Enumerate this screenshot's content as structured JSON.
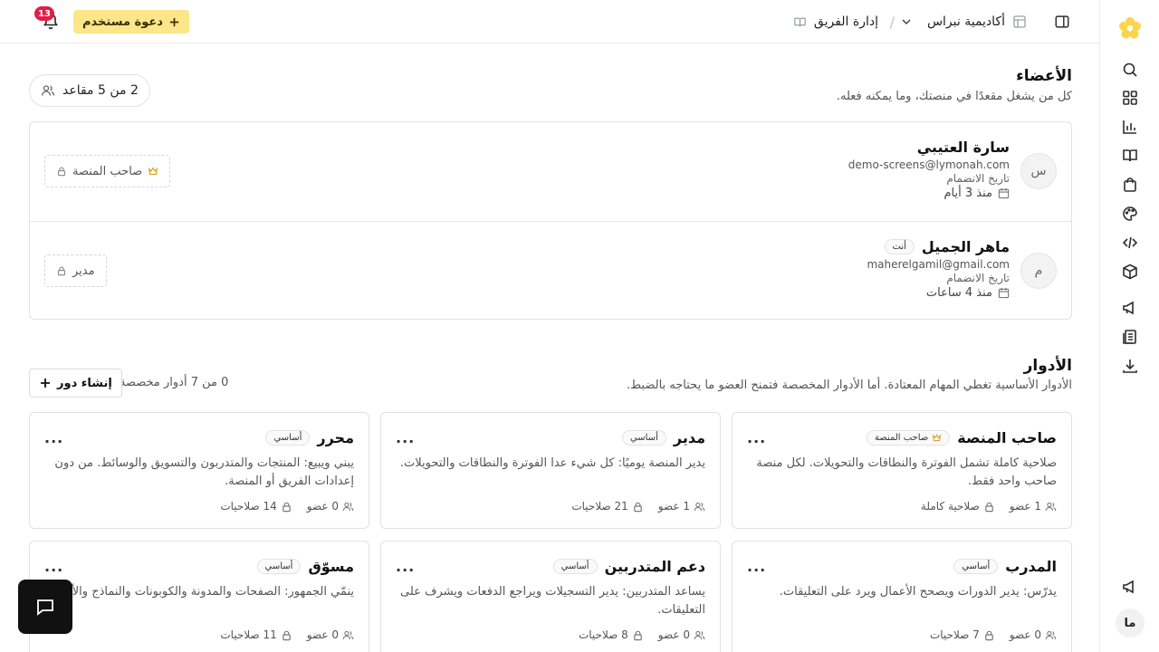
{
  "topbar": {
    "academy_name": "أكاديمية نبراس",
    "team_label": "إدارة الفريق",
    "invite_label": "دعوة مستخدم",
    "notifications_count": "13",
    "breadcrumb_separator": "/"
  },
  "members": {
    "title": "الأعضاء",
    "subtitle": "كل من يشغل مقعدًا في منصتك، وما يمكنه فعله.",
    "seats": "2 من 5 مقاعد",
    "rows": [
      {
        "avatar": "س",
        "name": "سارة العتيبي",
        "email": "demo-screens@lymonah.com",
        "joined_label": "تاريخ الانضمام",
        "joined": "منذ 3 أيام",
        "role": "صاحب المنصة",
        "you_badge": ""
      },
      {
        "avatar": "م",
        "name": "ماهر الجميل",
        "email": "maherelgamil@gmail.com",
        "joined_label": "تاريخ الانضمام",
        "joined": "منذ 4 ساعات",
        "role": "مدير",
        "you_badge": "أنت"
      }
    ]
  },
  "roles": {
    "title": "الأدوار",
    "subtitle": "الأدوار الأساسية تغطي المهام المعتادة. أما الأدوار المخصصة فتمنح العضو ما يحتاجه بالضبط.",
    "custom_count": "0 من 7 أدوار مخصصة",
    "create_label": "إنشاء دور",
    "more": "...",
    "cards": [
      {
        "title": "صاحب المنصة",
        "badge": "صاحب المنصة",
        "desc": "صلاحية كاملة تشمل الفوترة والنطاقات والتحويلات. لكل منصة صاحب واحد فقط.",
        "members": "1 عضو",
        "perms": "صلاحية كاملة"
      },
      {
        "title": "مدير",
        "badge": "أساسي",
        "desc": "يدير المنصة يوميًا: كل شيء عدا الفوترة والنطاقات والتحويلات.",
        "members": "1 عضو",
        "perms": "21 صلاحيات"
      },
      {
        "title": "محرر",
        "badge": "أساسي",
        "desc": "يبني ويبيع: المنتجات والمتدربون والتسويق والوسائط. من دون إعدادات الفريق أو المنصة.",
        "members": "0 عضو",
        "perms": "14 صلاحيات"
      },
      {
        "title": "المدرب",
        "badge": "أساسي",
        "desc": "يدرّس: يدير الدورات ويصحح الأعمال ويرد على التعليقات.",
        "members": "0 عضو",
        "perms": "7 صلاحيات"
      },
      {
        "title": "دعم المتدربين",
        "badge": "أساسي",
        "desc": "يساعد المتدربين: يدير التسجيلات ويراجع الدفعات ويشرف على التعليقات.",
        "members": "0 عضو",
        "perms": "8 صلاحيات"
      },
      {
        "title": "مسوّق",
        "badge": "أساسي",
        "desc": "ينمّي الجمهور: الصفحات والمدونة والكوبونات والنماذج والأتمتة.",
        "members": "0 عضو",
        "perms": "11 صلاحيات"
      }
    ]
  },
  "rail": {
    "user_initials": "ما",
    "icons": [
      "search-icon",
      "apps-icon",
      "chart-icon",
      "book-icon",
      "shopping-bag-icon",
      "palette-icon",
      "code-icon",
      "package-icon",
      "megaphone-icon",
      "document-icon",
      "download-icon",
      "megaphone-icon"
    ]
  },
  "colors": {
    "invite_bg": "#fde68a",
    "badge_red": "#e11d48",
    "logo_yellow": "#fcd34d",
    "chat_bg": "#111111"
  }
}
